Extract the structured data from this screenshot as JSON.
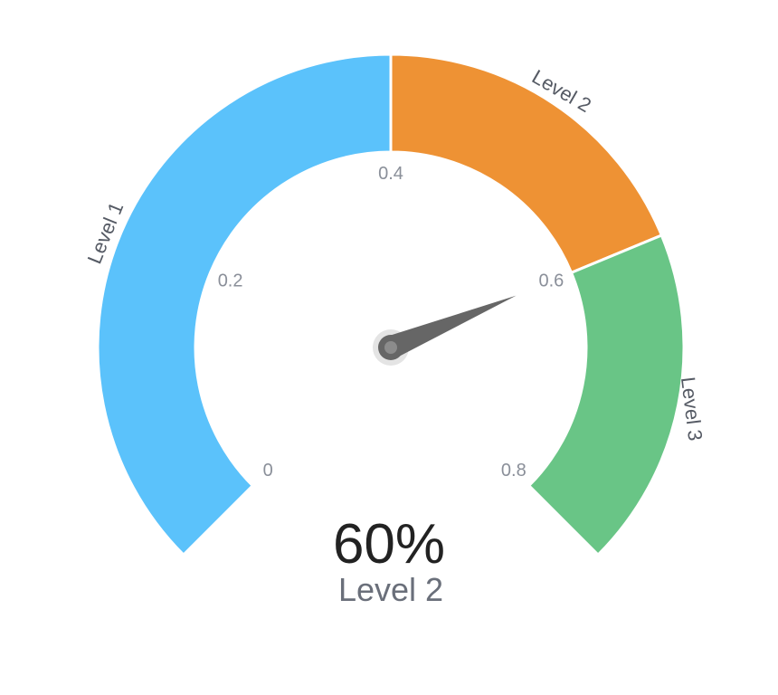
{
  "chart_data": {
    "type": "gauge",
    "min": 0,
    "max": 0.8,
    "value": 0.6,
    "value_text": "60%",
    "status_text": "Level 2",
    "ticks": [
      {
        "value": 0,
        "label": "0"
      },
      {
        "value": 0.2,
        "label": "0.2"
      },
      {
        "value": 0.4,
        "label": "0.4"
      },
      {
        "value": 0.6,
        "label": "0.6"
      },
      {
        "value": 0.8,
        "label": "0.8"
      }
    ],
    "bands": [
      {
        "label": "Level 1",
        "from": 0,
        "to": 0.4,
        "color": "#5bc2fb"
      },
      {
        "label": "Level 2",
        "from": 0.4,
        "to": 0.6,
        "color": "#ee9234"
      },
      {
        "label": "Level 3",
        "from": 0.6,
        "to": 0.8,
        "color": "#69c586"
      }
    ],
    "needle_color": "#666666"
  }
}
